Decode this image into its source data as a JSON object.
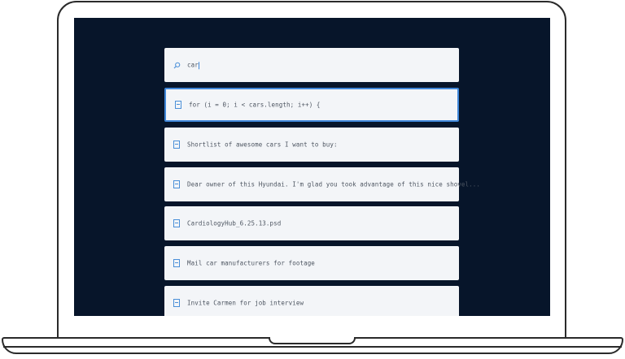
{
  "search": {
    "query": "car"
  },
  "results": [
    {
      "text": "for (i = 0; i < cars.length; i++) {",
      "selected": true
    },
    {
      "text": "Shortlist of awesome cars I want to buy:",
      "selected": false
    },
    {
      "text": "Dear owner of this Hyundai. I'm glad you took advantage of this nice shovel...",
      "selected": false
    },
    {
      "text": "CardiologyHub_6.25.13.psd",
      "selected": false
    },
    {
      "text": "Mail car manufacturers for footage",
      "selected": false
    },
    {
      "text": "Invite Carmen for job interview",
      "selected": false
    }
  ],
  "colors": {
    "screen_background": "#07152a",
    "card_background": "#f3f5f8",
    "accent": "#3f86d8"
  }
}
